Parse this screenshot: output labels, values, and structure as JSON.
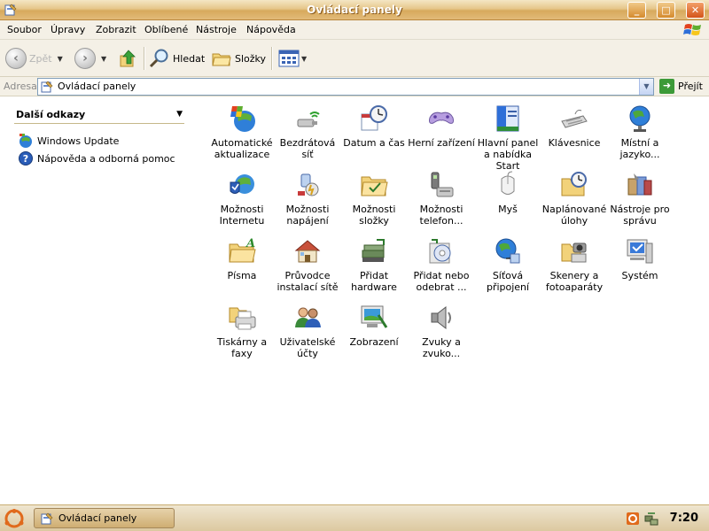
{
  "window": {
    "title": "Ovládací panely"
  },
  "menu": [
    "Soubor",
    "Úpravy",
    "Zobrazit",
    "Oblíbené",
    "Nástroje",
    "Nápověda"
  ],
  "toolbar": {
    "back_label": "Zpět",
    "search_label": "Hledat",
    "folders_label": "Složky"
  },
  "address": {
    "label": "Adresa",
    "value": "Ovládací panely",
    "go_label": "Přejít"
  },
  "left_pane": {
    "title": "Další odkazy",
    "links": [
      "Windows Update",
      "Nápověda a odborná pomoc"
    ]
  },
  "items": [
    {
      "label": "Automatické aktualizace",
      "icon": "globe-shield-icon"
    },
    {
      "label": "Bezdrátová síť",
      "icon": "wireless-icon"
    },
    {
      "label": "Datum a čas",
      "icon": "clock-icon"
    },
    {
      "label": "Herní zařízení",
      "icon": "gamepad-icon"
    },
    {
      "label": "Hlavní panel a nabídka Start",
      "icon": "taskbar-icon"
    },
    {
      "label": "Klávesnice",
      "icon": "keyboard-icon"
    },
    {
      "label": "Místní a jazyko...",
      "icon": "globe-icon"
    },
    {
      "label": "Možnosti Internetu",
      "icon": "internet-icon"
    },
    {
      "label": "Možnosti napájení",
      "icon": "power-icon"
    },
    {
      "label": "Možnosti složky",
      "icon": "folder-options-icon"
    },
    {
      "label": "Možnosti telefon...",
      "icon": "phone-icon"
    },
    {
      "label": "Myš",
      "icon": "mouse-icon"
    },
    {
      "label": "Naplánované úlohy",
      "icon": "scheduled-tasks-icon"
    },
    {
      "label": "Nástroje pro správu",
      "icon": "admin-tools-icon"
    },
    {
      "label": "Písma",
      "icon": "fonts-icon"
    },
    {
      "label": "Průvodce instalací sítě",
      "icon": "network-wizard-icon"
    },
    {
      "label": "Přidat hardware",
      "icon": "hardware-icon"
    },
    {
      "label": "Přidat nebo odebrat ...",
      "icon": "add-remove-icon"
    },
    {
      "label": "Síťová připojení",
      "icon": "network-connections-icon"
    },
    {
      "label": "Skenery a fotoaparáty",
      "icon": "scanner-camera-icon"
    },
    {
      "label": "Systém",
      "icon": "system-icon"
    },
    {
      "label": "Tiskárny a faxy",
      "icon": "printer-icon"
    },
    {
      "label": "Uživatelské účty",
      "icon": "users-icon"
    },
    {
      "label": "Zobrazení",
      "icon": "display-icon"
    },
    {
      "label": "Zvuky a zvuko...",
      "icon": "speaker-icon"
    }
  ],
  "taskbar": {
    "task_label": "Ovládací panely",
    "clock": "7:20"
  }
}
